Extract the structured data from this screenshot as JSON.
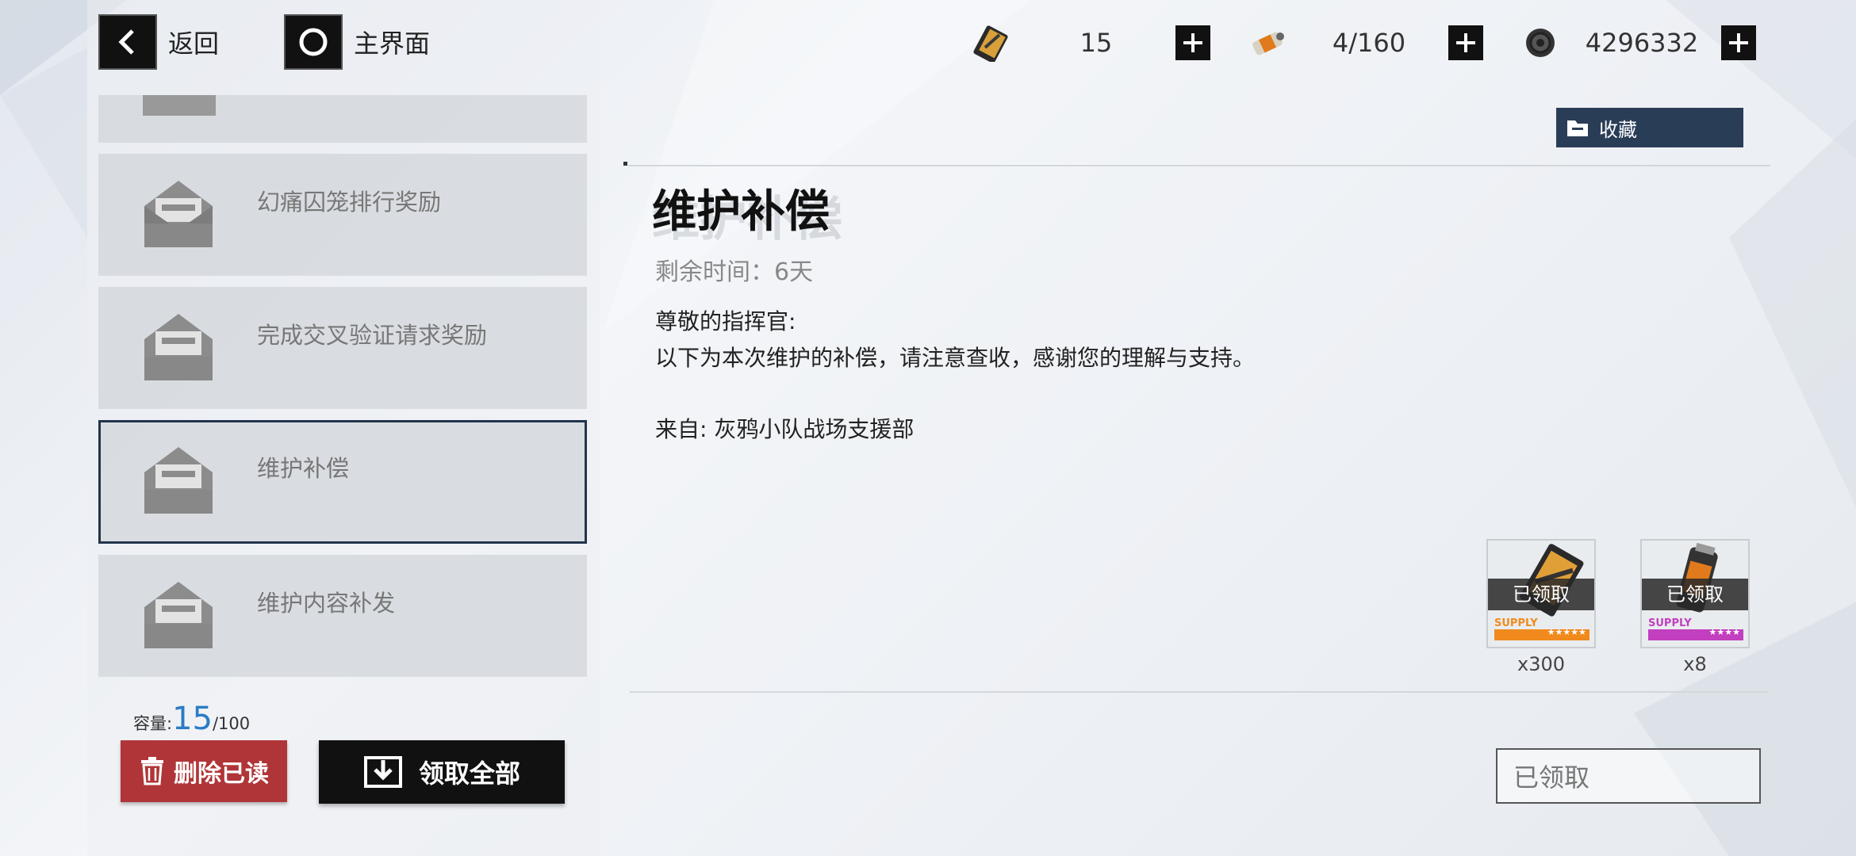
{
  "topbar": {
    "back_label": "返回",
    "home_label": "主界面",
    "resources": [
      {
        "name": "card-ticket",
        "value": "15"
      },
      {
        "name": "battery",
        "value": "4/160"
      },
      {
        "name": "coin",
        "value": "4296332"
      }
    ]
  },
  "mail_list": [
    {
      "title": ""
    },
    {
      "title": "幻痛囚笼排行奖励"
    },
    {
      "title": "完成交叉验证请求奖励"
    },
    {
      "title": "维护补偿"
    },
    {
      "title": "维护内容补发"
    }
  ],
  "capacity": {
    "label": "容量:",
    "current": "15",
    "max": "/100"
  },
  "buttons": {
    "delete_read": "删除已读",
    "claim_all": "领取全部",
    "favorite": "收藏",
    "claimed": "已领取"
  },
  "mail": {
    "title": "维护补偿",
    "title_shadow": "维护补偿",
    "remaining": "剩余时间：6天",
    "greeting": "尊敬的指挥官:",
    "body": "以下为本次维护的补偿，请注意查收，感谢您的理解与支持。",
    "sender": "来自: 灰鸦小队战场支援部"
  },
  "rewards": [
    {
      "status": "已领取",
      "supply": "SUPPLY",
      "stars": "★★★★★",
      "qty": "x300",
      "color": "#f08a1c"
    },
    {
      "status": "已领取",
      "supply": "SUPPLY",
      "stars": "★★★★",
      "qty": "x8",
      "color": "#c23fbf"
    }
  ],
  "colors": {
    "selected_border": "#22344d",
    "delete_red": "#b03538",
    "capacity_blue": "#2b7bc7",
    "favorite_bg": "#2a3d57"
  }
}
